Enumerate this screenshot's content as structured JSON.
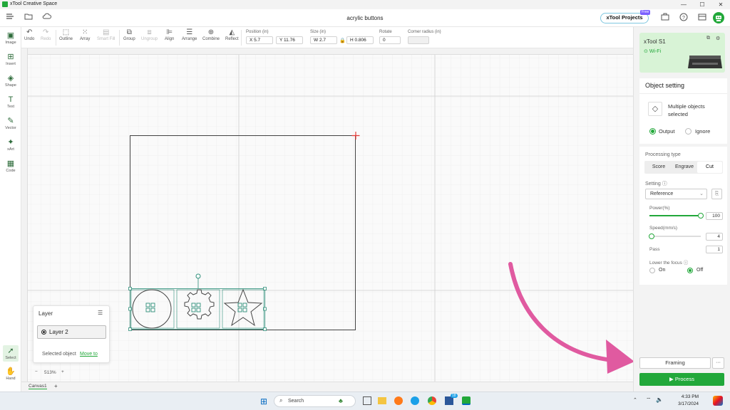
{
  "window": {
    "title": "xTool Creative Space",
    "minimize": "—",
    "maximize": "☐",
    "close": "✕"
  },
  "header": {
    "doc_title": "acrylic buttons",
    "projects_label": "xTool Projects",
    "free_badge": "Free"
  },
  "toolbar": {
    "undo": "Undo",
    "redo": "Redo",
    "outline": "Outline",
    "array": "Array",
    "smart_fill": "Smart Fill",
    "group": "Group",
    "ungroup": "Ungroup",
    "align": "Align",
    "arrange": "Arrange",
    "combine": "Combine",
    "reflect": "Reflect",
    "position_label": "Position (in)",
    "x_value": "X 5.7",
    "y_value": "Y 11.76",
    "size_label": "Size (in)",
    "w_value": "W 2.7",
    "h_value": "H 0.806",
    "rotate_label": "Rotate",
    "rotate_value": "0",
    "corner_label": "Corner radius (in)",
    "corner_value": ""
  },
  "sidebar": {
    "image": "Image",
    "insert": "Insert",
    "shape": "Shape",
    "text": "Text",
    "vector": "Vector",
    "xart": "xArt",
    "code": "Code",
    "select": "Select",
    "hand": "Hand"
  },
  "layer_popup": {
    "title": "Layer",
    "layer_name": "Layer 2",
    "selected_text": "Selected object",
    "move_link": "Move to"
  },
  "canvas": {
    "zoom": "513%",
    "tab": "Canvas1",
    "add_tab": "+"
  },
  "device": {
    "name": "xTool S1",
    "connection": "Wi-Fi"
  },
  "object_setting": {
    "title": "Object setting",
    "selection_label": "Multiple objects selected",
    "output": "Output",
    "ignore": "Ignore",
    "processing_type_label": "Processing type",
    "types": [
      "Score",
      "Engrave",
      "Cut"
    ],
    "active_type": "Cut",
    "setting_label": "Setting",
    "setting_value": "Reference",
    "power_label": "Power(%)",
    "power_value": "100",
    "power_fraction": 1.0,
    "speed_label": "Speed(mm/s)",
    "speed_value": "4",
    "speed_fraction": 0.0,
    "pass_label": "Pass",
    "pass_value": "1",
    "focus_label": "Lower the focus",
    "focus_on": "On",
    "focus_off": "Off"
  },
  "actions": {
    "framing": "Framing",
    "more": "···",
    "process": "Process"
  },
  "taskbar": {
    "search_placeholder": "Search",
    "time": "4:33 PM",
    "date": "3/17/2024",
    "badge": "18"
  },
  "colors": {
    "brand_green": "#22a83a",
    "selection_teal": "#2f8f7a",
    "arrow_pink": "#e05aa0",
    "device_bg": "#d8f3d6"
  }
}
